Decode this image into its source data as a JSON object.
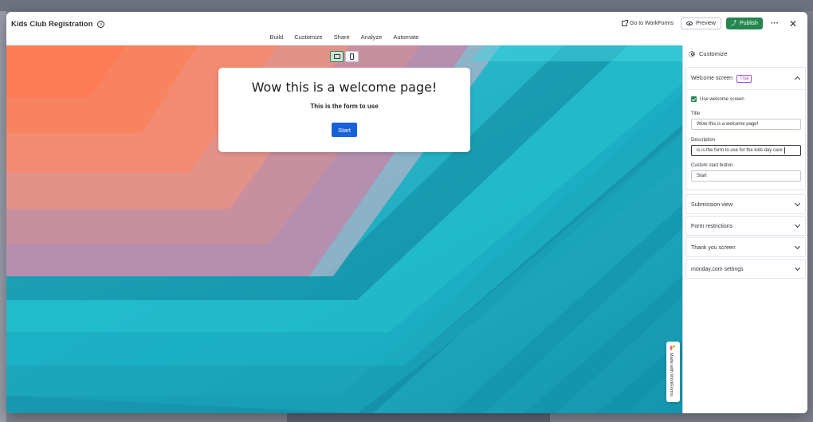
{
  "app": {
    "title": "Kids Club Registration"
  },
  "tabs": [
    "Build",
    "Customize",
    "Share",
    "Analyze",
    "Automate"
  ],
  "header_actions": {
    "go_to": "Go to WorkForms",
    "preview": "Preview",
    "publish": "Publish"
  },
  "preview": {
    "welcome_title": "Wow this is a welcome page!",
    "welcome_description": "This is the form to use",
    "start_button": "Start",
    "made_with": "Made with WorkForms"
  },
  "panel": {
    "heading": "Customize",
    "welcome_section": {
      "label": "Welcome screen",
      "badge": "Trial",
      "use_welcome_label": "Use welcome screen",
      "use_welcome_checked": true,
      "title_label": "Title",
      "title_value": "Wow this is a welcome page!",
      "description_label": "Description",
      "description_value": "is is the form to use for the kids day care",
      "custom_start_label": "Custom start button",
      "custom_start_value": "Start"
    },
    "collapsed_sections": [
      "Submission view",
      "Form restrictions",
      "Thank you screen",
      "monday.com settings"
    ]
  },
  "colors": {
    "publish": "#258750",
    "start_button": "#1762d8",
    "trial_badge": "#9d50dd"
  }
}
